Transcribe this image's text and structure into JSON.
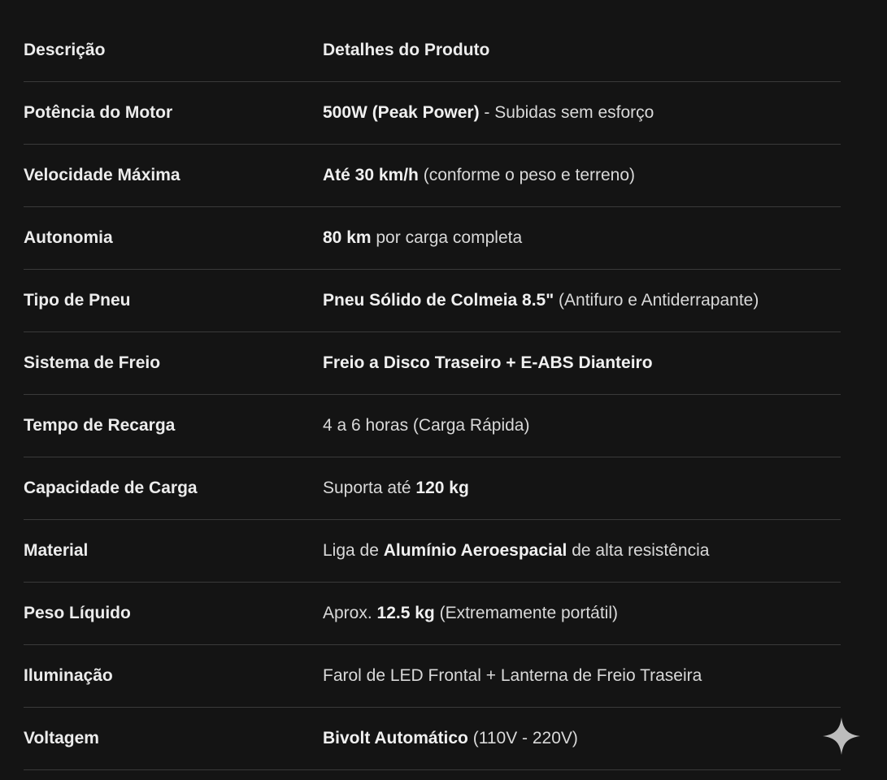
{
  "table": {
    "headers": {
      "label": "Descrição",
      "value": "Detalhes do Produto"
    },
    "rows": [
      {
        "label": "Potência do Motor",
        "value": [
          {
            "text": "500W (Peak Power)",
            "bold": true
          },
          {
            "text": " - Subidas sem esforço",
            "bold": false
          }
        ]
      },
      {
        "label": "Velocidade Máxima",
        "value": [
          {
            "text": "Até 30 km/h",
            "bold": true
          },
          {
            "text": " (conforme o peso e terreno)",
            "bold": false
          }
        ]
      },
      {
        "label": "Autonomia",
        "value": [
          {
            "text": "80 km",
            "bold": true
          },
          {
            "text": " por carga completa",
            "bold": false
          }
        ]
      },
      {
        "label": "Tipo de Pneu",
        "value": [
          {
            "text": "Pneu Sólido de Colmeia 8.5\"",
            "bold": true
          },
          {
            "text": " (Antifuro e Antiderrapante)",
            "bold": false
          }
        ]
      },
      {
        "label": "Sistema de Freio",
        "value": [
          {
            "text": "Freio a Disco Traseiro + E-ABS Dianteiro",
            "bold": true
          }
        ]
      },
      {
        "label": "Tempo de Recarga",
        "value": [
          {
            "text": "4 a 6 horas (Carga Rápida)",
            "bold": false
          }
        ]
      },
      {
        "label": "Capacidade de Carga",
        "value": [
          {
            "text": "Suporta até ",
            "bold": false
          },
          {
            "text": "120 kg",
            "bold": true
          }
        ]
      },
      {
        "label": "Material",
        "value": [
          {
            "text": "Liga de ",
            "bold": false
          },
          {
            "text": "Alumínio Aeroespacial",
            "bold": true
          },
          {
            "text": " de alta resistência",
            "bold": false
          }
        ]
      },
      {
        "label": "Peso Líquido",
        "value": [
          {
            "text": "Aprox. ",
            "bold": false
          },
          {
            "text": "12.5 kg",
            "bold": true
          },
          {
            "text": " (Extremamente portátil)",
            "bold": false
          }
        ]
      },
      {
        "label": "Iluminação",
        "value": [
          {
            "text": "Farol de LED Frontal + Lanterna de Freio Traseira",
            "bold": false
          }
        ]
      },
      {
        "label": "Voltagem",
        "value": [
          {
            "text": "Bivolt Automático",
            "bold": true
          },
          {
            "text": " (110V - 220V)",
            "bold": false
          }
        ]
      }
    ]
  },
  "icons": {
    "corner": "sparkle-icon"
  },
  "colors": {
    "background": "#141414",
    "text": "#e6e6e6",
    "divider": "#3a3a3a"
  }
}
